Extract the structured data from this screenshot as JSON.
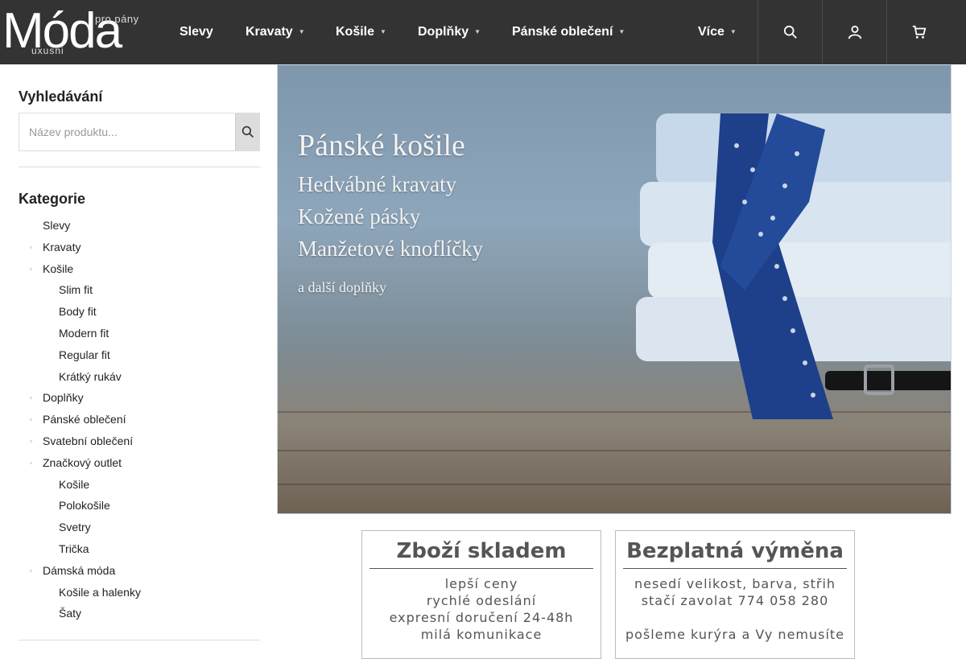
{
  "logo": {
    "main": "Móda",
    "top": "pro pány",
    "bottom": "uxusni"
  },
  "nav": [
    {
      "label": "Slevy",
      "caret": false
    },
    {
      "label": "Kravaty",
      "caret": true
    },
    {
      "label": "Košile",
      "caret": true
    },
    {
      "label": "Doplňky",
      "caret": true
    },
    {
      "label": "Pánské oblečení",
      "caret": true
    },
    {
      "label": "Více",
      "caret": true
    }
  ],
  "header_icons": [
    "search-icon",
    "user-icon",
    "cart-icon"
  ],
  "sidebar": {
    "search_title": "Vyhledávání",
    "search_placeholder": "Název produktu...",
    "categories_title": "Kategorie",
    "categories": [
      {
        "label": "Slevy",
        "level": 1,
        "bullet": false
      },
      {
        "label": "Kravaty",
        "level": 1,
        "bullet": true
      },
      {
        "label": "Košile",
        "level": 1,
        "bullet": true
      },
      {
        "label": "Slim fit",
        "level": 2,
        "bullet": false
      },
      {
        "label": "Body fit",
        "level": 2,
        "bullet": false
      },
      {
        "label": "Modern fit",
        "level": 2,
        "bullet": false
      },
      {
        "label": "Regular fit",
        "level": 2,
        "bullet": false
      },
      {
        "label": "Krátký rukáv",
        "level": 2,
        "bullet": false
      },
      {
        "label": "Doplňky",
        "level": 1,
        "bullet": true
      },
      {
        "label": "Pánské oblečení",
        "level": 1,
        "bullet": true
      },
      {
        "label": "Svatební oblečení",
        "level": 1,
        "bullet": true
      },
      {
        "label": "Značkový outlet",
        "level": 1,
        "bullet": true
      },
      {
        "label": "Košile",
        "level": 2,
        "bullet": false
      },
      {
        "label": "Polokošile",
        "level": 2,
        "bullet": false
      },
      {
        "label": "Svetry",
        "level": 2,
        "bullet": false
      },
      {
        "label": "Trička",
        "level": 2,
        "bullet": false
      },
      {
        "label": "Dámská móda",
        "level": 1,
        "bullet": true
      },
      {
        "label": "Košile a halenky",
        "level": 2,
        "bullet": false
      },
      {
        "label": "Šaty",
        "level": 2,
        "bullet": false
      }
    ]
  },
  "banner": {
    "title": "Pánské košile",
    "lines": [
      "Hedvábné kravaty",
      "Kožené pásky",
      "Manžetové knoflíčky"
    ],
    "footer": "a další doplňky"
  },
  "info_boxes": [
    {
      "title": "Zboží skladem",
      "lines": [
        "lepší ceny",
        "rychlé odeslání",
        "expresní doručení 24-48h",
        "milá komunikace"
      ]
    },
    {
      "title": "Bezplatná výměna",
      "lines": [
        "nesedí velikost, barva, střih",
        "stačí zavolat 774 058 280",
        "",
        "pošleme kurýra a Vy nemusíte"
      ]
    }
  ],
  "colors": {
    "header_bg": "#333333",
    "banner_sky": "#7f97ad",
    "tie_blue": "#1e3f8a",
    "info_text": "#555555"
  }
}
